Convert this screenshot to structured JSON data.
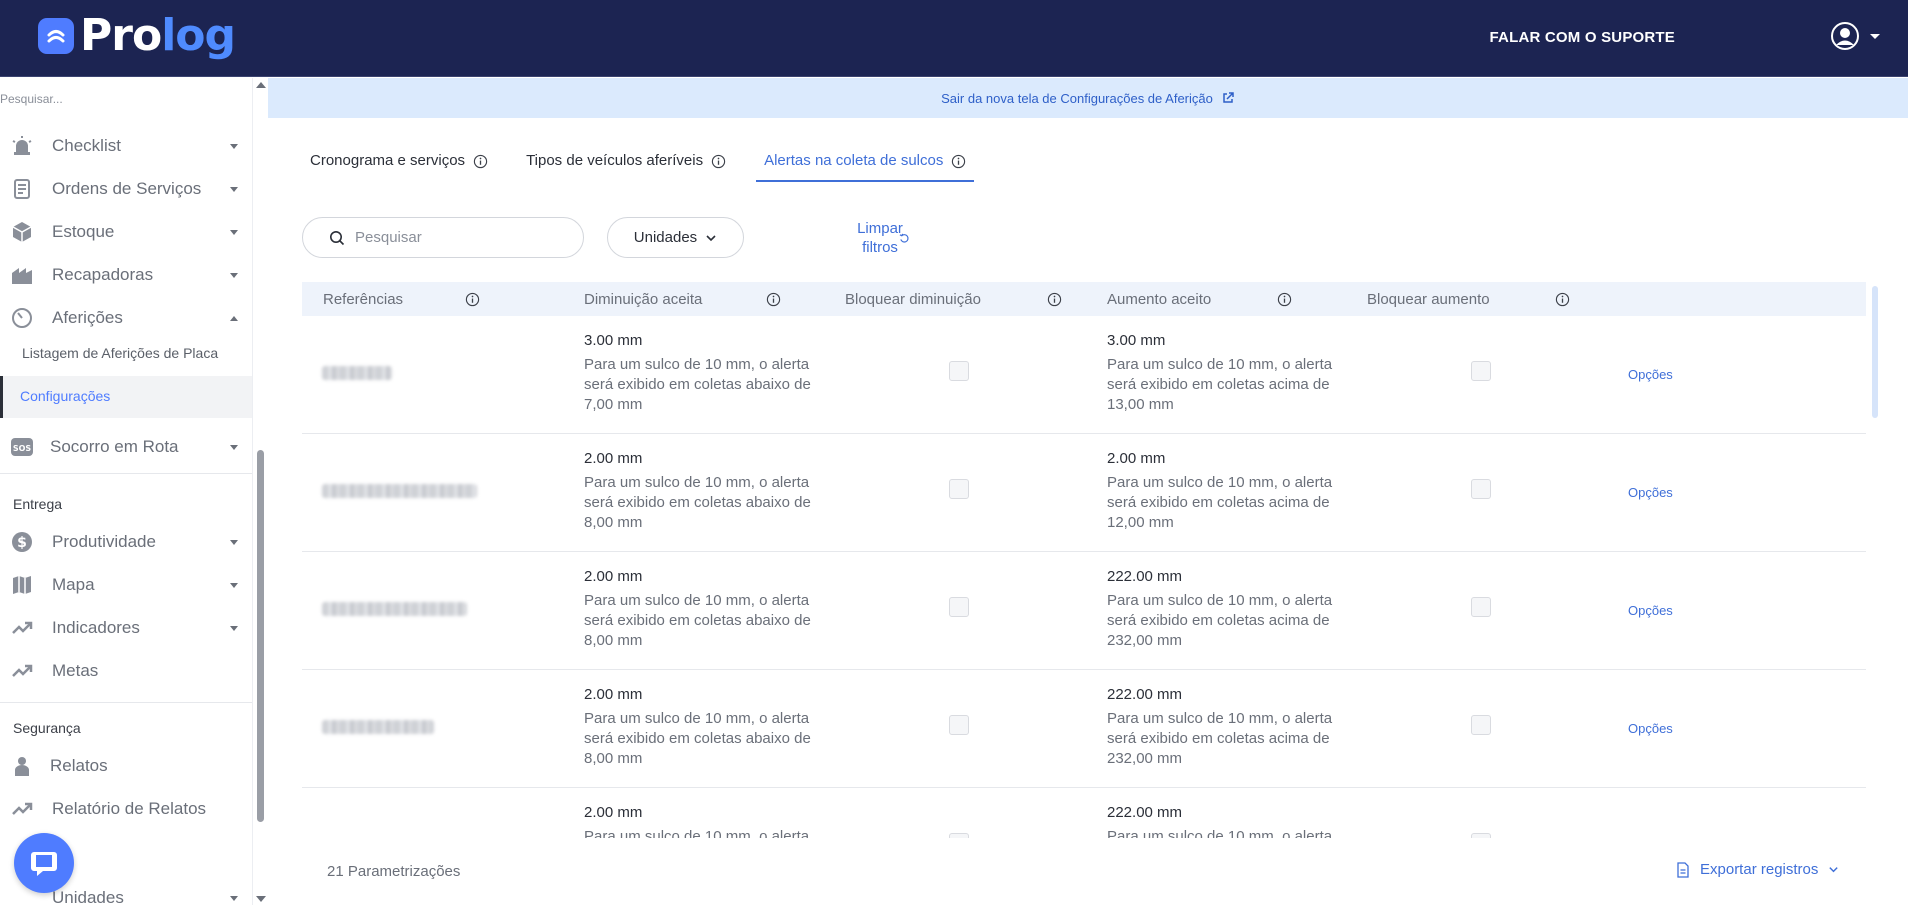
{
  "header": {
    "logo_text_a": "Pro",
    "logo_text_b": "log",
    "support_label": "FALAR COM O SUPORTE",
    "colors": {
      "bar": "#1c2452",
      "accent": "#4f7cff"
    }
  },
  "sidebar": {
    "search_placeholder": "Pesquisar...",
    "items": [
      {
        "label": "Checklist",
        "icon": "alarm-light-icon"
      },
      {
        "label": "Ordens de Serviços",
        "icon": "document-icon"
      },
      {
        "label": "Estoque",
        "icon": "boxes-icon"
      },
      {
        "label": "Recapadoras",
        "icon": "building-icon"
      },
      {
        "label": "Aferições",
        "icon": "gauge-icon"
      },
      {
        "label": "Socorro em Rota",
        "icon": "sos-icon"
      }
    ],
    "afericoes_sub": [
      "Listagem de Aferições de Placa",
      "Configurações"
    ],
    "section_entrega": "Entrega",
    "entrega_items": [
      {
        "label": "Produtividade",
        "icon": "dollar-icon"
      },
      {
        "label": "Mapa",
        "icon": "map-icon"
      },
      {
        "label": "Indicadores",
        "icon": "trending-up-icon"
      },
      {
        "label": "Metas",
        "icon": "trending-up-icon"
      }
    ],
    "section_seguranca": "Segurança",
    "seguranca_items": [
      {
        "label": "Relatos",
        "icon": "person-icon"
      },
      {
        "label": "Relatório de Relatos",
        "icon": "trending-up-icon"
      }
    ],
    "cut_item": "Unidades"
  },
  "banner": {
    "text": "Sair da nova tela de Configurações de Aferição"
  },
  "tabs": [
    {
      "label": "Cronograma e serviços"
    },
    {
      "label": "Tipos de veículos aferíveis"
    },
    {
      "label": "Alertas na coleta de sulcos"
    }
  ],
  "filters": {
    "search_placeholder": "Pesquisar",
    "units_label": "Unidades",
    "clear_line1": "Limpar",
    "clear_line2": "filtros"
  },
  "table": {
    "headers": [
      "Referências",
      "Diminuição aceita",
      "Bloquear diminuição",
      "Aumento aceito",
      "Bloquear aumento"
    ],
    "option_label": "Opções",
    "rows": [
      {
        "dec_value": "3.00 mm",
        "dec_desc": "Para um sulco de 10 mm, o alerta será exibido em coletas abaixo de 7,00 mm",
        "inc_value": "3.00 mm",
        "inc_desc": "Para um sulco de 10 mm, o alerta será exibido em coletas acima de 13,00 mm"
      },
      {
        "dec_value": "2.00 mm",
        "dec_desc": "Para um sulco de 10 mm, o alerta será exibido em coletas abaixo de 8,00 mm",
        "inc_value": "2.00 mm",
        "inc_desc": "Para um sulco de 10 mm, o alerta será exibido em coletas acima de 12,00 mm"
      },
      {
        "dec_value": "2.00 mm",
        "dec_desc": "Para um sulco de 10 mm, o alerta será exibido em coletas abaixo de 8,00 mm",
        "inc_value": "222.00 mm",
        "inc_desc": "Para um sulco de 10 mm, o alerta será exibido em coletas acima de 232,00 mm"
      },
      {
        "dec_value": "2.00 mm",
        "dec_desc": "Para um sulco de 10 mm, o alerta será exibido em coletas abaixo de 8,00 mm",
        "inc_value": "222.00 mm",
        "inc_desc": "Para um sulco de 10 mm, o alerta será exibido em coletas acima de 232,00 mm"
      },
      {
        "dec_value": "2.00 mm",
        "dec_desc": "Para um sulco de 10 mm, o alerta",
        "inc_value": "222.00 mm",
        "inc_desc": "Para um sulco de 10 mm, o alerta"
      }
    ]
  },
  "footer": {
    "count_label": "21 Parametrizações",
    "export_label": "Exportar registros"
  }
}
